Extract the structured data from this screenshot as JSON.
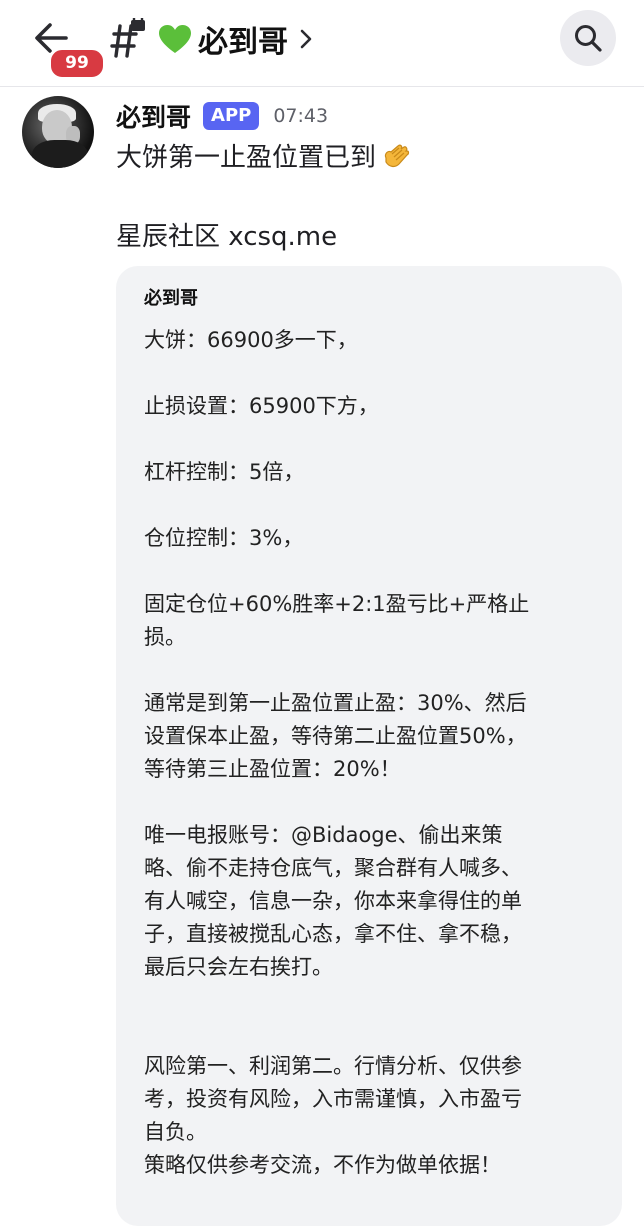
{
  "header": {
    "back_label": "back",
    "unread_badge": "99",
    "channel_title": "必到哥"
  },
  "message": {
    "author": "必到哥",
    "app_tag": "APP",
    "time": "07:43",
    "text_line1": "大饼第一止盈位置已到",
    "text_line2": "星辰社区 xcsq.me"
  },
  "embed": {
    "author": "必到哥",
    "lines": [
      "大饼：66900多一下，",
      "止损设置：65900下方，",
      "杠杆控制：5倍，",
      "仓位控制：3%，",
      "固定仓位+60%胜率+2:1盈亏比+严格止",
      "损。",
      "通常是到第一止盈位置止盈：30%、然后",
      "设置保本止盈，等待第二止盈位置50%，",
      "等待第三止盈位置：20%！",
      "唯一电报账号：@Bidaoge、偷出来策",
      "略、偷不走持仓底气，聚合群有人喊多、",
      "有人喊空，信息一杂，你本来拿得住的单",
      "子，直接被搅乱心态，拿不住、拿不稳，",
      "最后只会左右挨打。",
      "风险第一、利润第二。行情分析、仅供参",
      "考，投资有风险，入市需谨慎，入市盈亏",
      "自负。",
      "策略仅供参考交流，不作为做单依据！"
    ]
  },
  "icons": {
    "back": "arrow-left-icon",
    "channel": "hashtag-lock-icon",
    "heart": "green-heart-icon",
    "chevron": "chevron-right-icon",
    "search": "search-icon",
    "clap": "clapping-hands-icon"
  },
  "colors": {
    "badge": "#d83a42",
    "app_tag": "#5865f2",
    "heart": "#5bbf3a",
    "embed_bg": "#f2f3f5"
  }
}
